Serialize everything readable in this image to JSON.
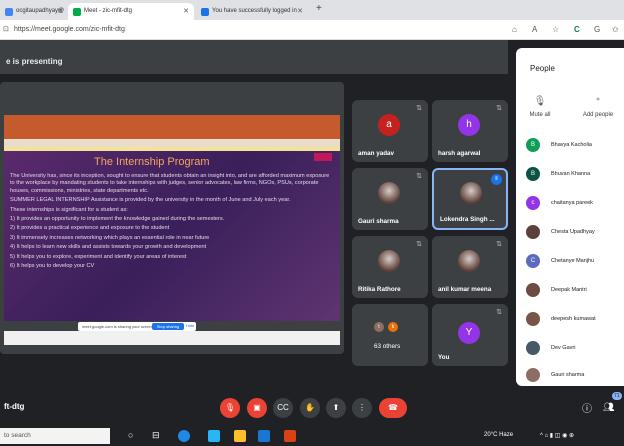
{
  "browser": {
    "tabs": [
      {
        "title": "ocgitaupadhyay@",
        "fav_color": "#4285f4"
      },
      {
        "title": "Meet - zic-mfit-dtg",
        "fav_color": "#00ac47"
      },
      {
        "title": "You have successfully logged in",
        "fav_color": "#1a73e8"
      }
    ],
    "new_tab": "+",
    "url": "https://meet.google.com/zic-mfit-dtg"
  },
  "meet": {
    "presenting_text": "e is presenting",
    "meeting_code": "ft-dtg",
    "slide": {
      "title": "The Internship Program",
      "paragraphs": [
        "The University has, since its inception, sought to ensure that students obtain an insight into, and are afforded maximum exposure to the workplace by mandating students to take internships with judges, senior advocates, law firms, NGOs, PSUs, corporate houses, commissions, ministries, state departments etc.",
        "SUMMER LEGAL INTERNSHIP Assistance is provided by the university in the month of June and July each year.",
        "These internships is significant for a student as:",
        "1) It provides an opportunity to implement the knowledge gained during the semesters.",
        "2) It provides a practical experience and exposure to the student",
        "3) It immensely increases networking which plays an essential role in near future",
        "4) It helps to learn new skills and assists towards your growth and development",
        "5) It helps you to explore, experiment and identify your areas of interest",
        "6) It helps you to develop your CV"
      ],
      "share_text": "meet.google.com is sharing your screen.",
      "stop_sharing": "Stop sharing",
      "hide": "Hide"
    },
    "tiles": [
      {
        "name": "aman yadav",
        "initial": "a",
        "color": "#c5221f",
        "photo": false
      },
      {
        "name": "harsh agarwal",
        "initial": "h",
        "color": "#9334e6",
        "photo": false
      },
      {
        "name": "Gauri sharma",
        "initial": "",
        "color": "",
        "photo": true
      },
      {
        "name": "Lokendra Singh ...",
        "initial": "",
        "color": "",
        "photo": true
      },
      {
        "name": "Ritika Rathore",
        "initial": "",
        "color": "",
        "photo": true
      },
      {
        "name": "anil kumar meena",
        "initial": "",
        "color": "",
        "photo": true
      },
      {
        "name": "63 others",
        "initial": "",
        "color": "",
        "photo": false
      },
      {
        "name": "You",
        "initial": "Y",
        "color": "#9334e6",
        "photo": false
      }
    ],
    "others_initials": [
      "t",
      "k"
    ],
    "people": {
      "title": "People",
      "mute_all": "Mute all",
      "add_people": "Add people",
      "list": [
        {
          "name": "Bhavya Kacholia",
          "initial": "B",
          "color": "#0f9d58"
        },
        {
          "name": "Bhuvan Khanna",
          "initial": "B",
          "color": "#0b5345"
        },
        {
          "name": "chaitanya pareek",
          "initial": "c",
          "color": "#9334e6"
        },
        {
          "name": "Chesta Upadhyay",
          "initial": "",
          "color": "#5d4037"
        },
        {
          "name": "Chetanye Manjhu",
          "initial": "C",
          "color": "#5c6bc0"
        },
        {
          "name": "Deepak Mantri",
          "initial": "",
          "color": "#6d4c41"
        },
        {
          "name": "deepesh kumawat",
          "initial": "",
          "color": "#795548"
        },
        {
          "name": "Dev Gavri",
          "initial": "",
          "color": "#455a64"
        },
        {
          "name": "Gauri sharma",
          "initial": "",
          "color": "#8d6e63"
        }
      ]
    },
    "participant_count": "71"
  },
  "taskbar": {
    "search_placeholder": "to search",
    "weather": "20°C Haze"
  }
}
